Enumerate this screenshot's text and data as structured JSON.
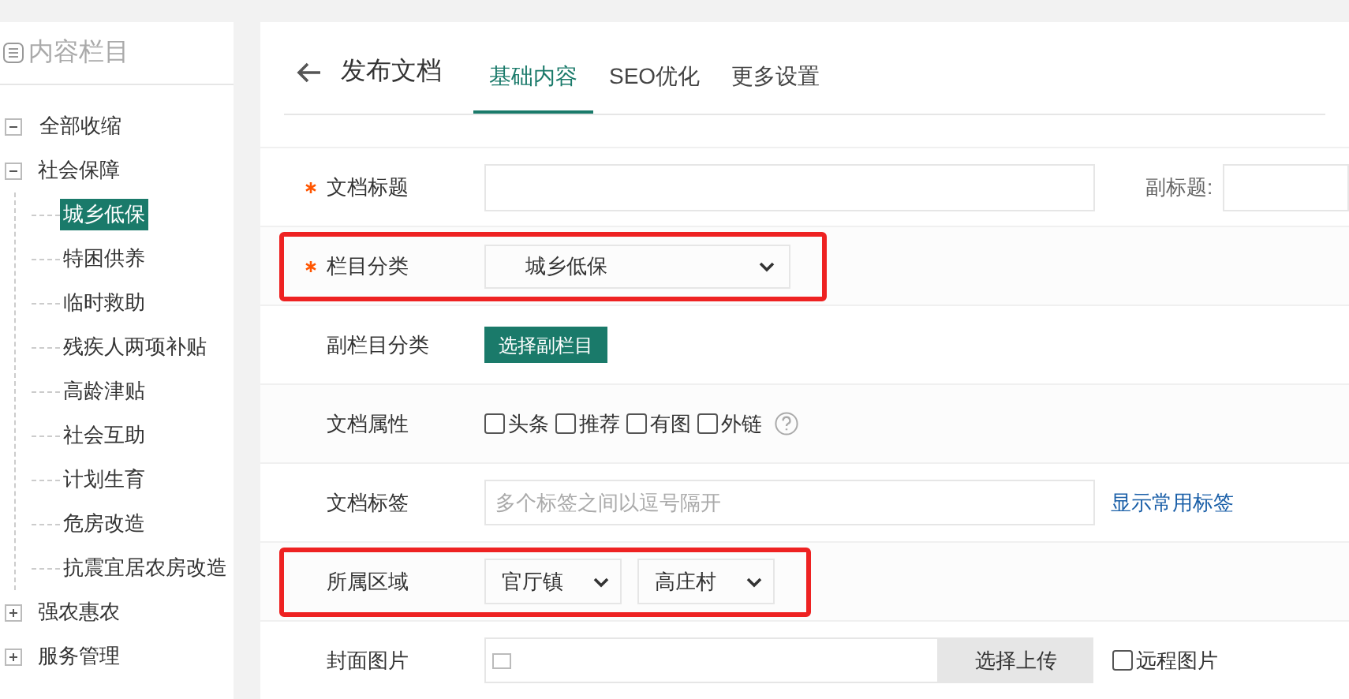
{
  "sidebar": {
    "title": "内容栏目",
    "collapse_all": {
      "label": "全部收缩",
      "expanded": true
    },
    "items": [
      {
        "label": "社会保障",
        "expanded": true,
        "selected": false,
        "children": [
          {
            "label": "城乡低保",
            "selected": true
          },
          {
            "label": "特困供养",
            "selected": false
          },
          {
            "label": "临时救助",
            "selected": false
          },
          {
            "label": "残疾人两项补贴",
            "selected": false
          },
          {
            "label": "高龄津贴",
            "selected": false
          },
          {
            "label": "社会互助",
            "selected": false
          },
          {
            "label": "计划生育",
            "selected": false
          },
          {
            "label": "危房改造",
            "selected": false
          },
          {
            "label": "抗震宜居农房改造",
            "selected": false
          }
        ]
      },
      {
        "label": "强农惠农",
        "expanded": false,
        "selected": false
      },
      {
        "label": "服务管理",
        "expanded": false,
        "selected": false
      }
    ]
  },
  "header": {
    "title": "发布文档",
    "tabs": [
      {
        "label": "基础内容",
        "selected": true
      },
      {
        "label": "SEO优化",
        "selected": false
      },
      {
        "label": "更多设置",
        "selected": false
      }
    ]
  },
  "form": [
    {
      "kind": "text",
      "label": "文档标题",
      "required": true,
      "highlighted": false,
      "extra_label": "副标题:"
    },
    {
      "kind": "select",
      "label": "栏目分类",
      "required": true,
      "highlighted": true,
      "value": "城乡低保"
    },
    {
      "kind": "button",
      "label": "副栏目分类",
      "required": false,
      "highlighted": false,
      "button": "选择副栏目"
    },
    {
      "kind": "checkboxes",
      "label": "文档属性",
      "required": false,
      "highlighted": false,
      "options": [
        {
          "label": "头条",
          "checked": false
        },
        {
          "label": "推荐",
          "checked": false
        },
        {
          "label": "有图",
          "checked": false
        },
        {
          "label": "外链",
          "checked": false
        }
      ]
    },
    {
      "kind": "tags",
      "label": "文档标签",
      "required": false,
      "highlighted": false,
      "placeholder": "多个标签之间以逗号隔开",
      "link": "显示常用标签"
    },
    {
      "kind": "selects",
      "label": "所属区域",
      "required": false,
      "highlighted": true,
      "values": [
        "官厅镇",
        "高庄村"
      ]
    },
    {
      "kind": "upload",
      "label": "封面图片",
      "required": false,
      "highlighted": false,
      "button": "选择上传",
      "option": {
        "label": "远程图片",
        "checked": false
      }
    }
  ]
}
